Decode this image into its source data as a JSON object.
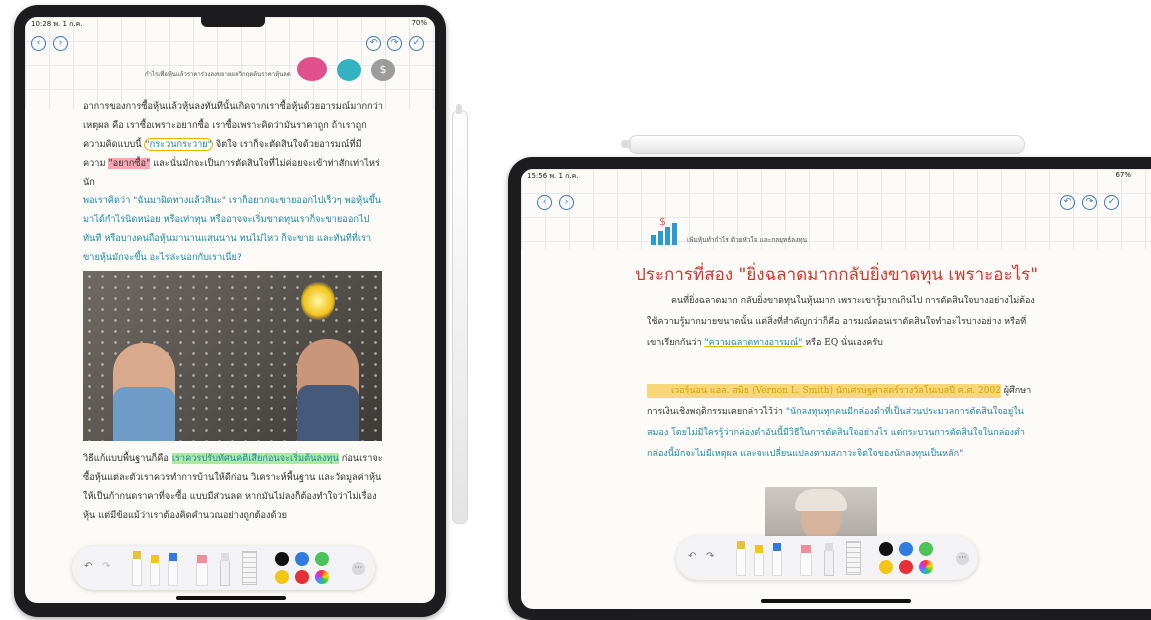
{
  "left_ipad": {
    "status_time": "10:28 พ. 1 ก.ค.",
    "status_right": "70%",
    "header_text": "กำไรเพื่อหุ้นแล้วราคาร่วงลงขยายผลวิกฤตต้นราคาหุ้นลด",
    "paragraph1": "อาการของการซื้อหุ้นแล้วหุ้นลงทันทีนั้นเกิดจากเราซื้อหุ้นด้วยอารมณ์มากกว่าเหตุผล คือ เราซื้อเพราะอยากซื้อ เราซื้อเพราะคิดว่ามันราคาถูก ถ้าเราถูกความคิดแบบนี้",
    "quote_anxious": "\"กระวนกระวาย\"",
    "p1_mid": "จิตใจ เราก็จะตัดสินใจด้วยอารมณ์ที่มีความ",
    "quote_want": "\"อยากซื้อ\"",
    "p1_end": "และนั่นมักจะเป็นการตัดสินใจที่ไม่ค่อยจะเข้าท่าสักเท่าไหร่นัก",
    "paragraph2": "พอเราคิดว่า \"ฉันมาผิดทางแล้วสินะ\" เราก็อยากจะขายออกไปเร็วๆ พอหุ้นขึ้นมาได้กำไรนิดหน่อย หรือเท่าทุน หรืออาจจะเริ่มขาดทุนเราก็จะขายออกไปทันที หรือบางคนถือหุ้นมานานแสนนาน ทนไม่ไหว ก็จะขาย และทันทีที่เราขายหุ้นมักจะขึ้น อะไรล่ะนอกกับเราเนี่ย?",
    "paragraph3_start": "วิธีแก้แบบพื้นฐานก็คือ",
    "paragraph3_highlight": "เราควรปรับทัศนคติเสียก่อนจะเริ่มต้นลงทุน",
    "paragraph3_rest": "ก่อนเราจะซื้อหุ้นแต่ละตัวเราควรทำการบ้านให้ดีก่อน วิเคราะห์พื้นฐาน และวัดมูลค่าหุ้นให้เป็นก้ากนดราคาที่จะซื้อ แบบมีส่วนลด หากมันไม่ลงก็ต้องทำใจว่าไม่เรื่องหุ้น แต่มีข้อแม้ว่าเราต้องคิดคำนวณอย่างถูกต้องด้วย",
    "toolbar_more": "···"
  },
  "right_ipad": {
    "status_time": "15:56 พ. 1 ก.ค.",
    "status_right": "67%",
    "header_text": "เพิ่มหุ้นทำกำไร ด้วยหัวใจ และกลยุทธ์ลงทุน",
    "title": "ประการที่สอง \"ยิ่งฉลาดมากกลับยิ่งขาดทุน เพราะอะไร\"",
    "para1": "คนที่ยิ่งฉลาดมาก กลับยิ่งขาดทุนในหุ้นมาก เพราะเขารู้มากเกินไป การตัดสินใจบางอย่างไม่ต้องใช้ความรู้มากมายขนาดนั้น แต่สิ่งที่สำคัญกว่าก็คือ อารมณ์ตอนเราตัดสินใจทำอะไรบางอย่าง หรือที่เขาเรียกกันว่า",
    "para1_underline": "\"ความฉลาดทางอารมณ์\"",
    "para1_end": "หรือ EQ นั่นเองครับ",
    "para2_highlight": "เวอร์นอน แอล. สมิธ (Vernon L. Smith) นักเศรษฐศาสตร์รางวัลโนเบลปี ค.ศ. 2002",
    "para2_start": "ผู้ศึกษาการเงินเชิงพฤติกรรมเคยกล่าวไว้ว่า",
    "para2_teal": "\"นักลงทุนทุกคนมีกล่องดำที่เป็นส่วนประมวลการตัดสินใจอยู่ในสมอง โดยไม่มีใครรู้ว่ากล่องดำอันนี้มีวิธีในการตัดสินใจอย่างไร แต่กระบวนการตัดสินใจในกล่องดำกล่องนี้มักจะไม่มีเหตุผล และจะเปลี่ยนแปลงตามสภาวะจิตใจของนักลงทุนเป็นหลัก\"",
    "toolbar_more": "···"
  },
  "icons": [
    "back-icon",
    "forward-icon",
    "undo-icon",
    "redo-icon",
    "done-check-icon",
    "speech-bubble-icon",
    "chart-icon",
    "coin-icon"
  ],
  "colors": {
    "accent": "#3a78c9",
    "highlight_pink": "#f7a5b3",
    "highlight_green": "#aee9a0",
    "highlight_yellow": "#f7d77a",
    "teal_text": "#1a8aa8",
    "title_red": "#d9332a",
    "palette": [
      "#111111",
      "#2f7be0",
      "#4cc25a",
      "#f3c515",
      "#e53035",
      "rainbow"
    ]
  }
}
